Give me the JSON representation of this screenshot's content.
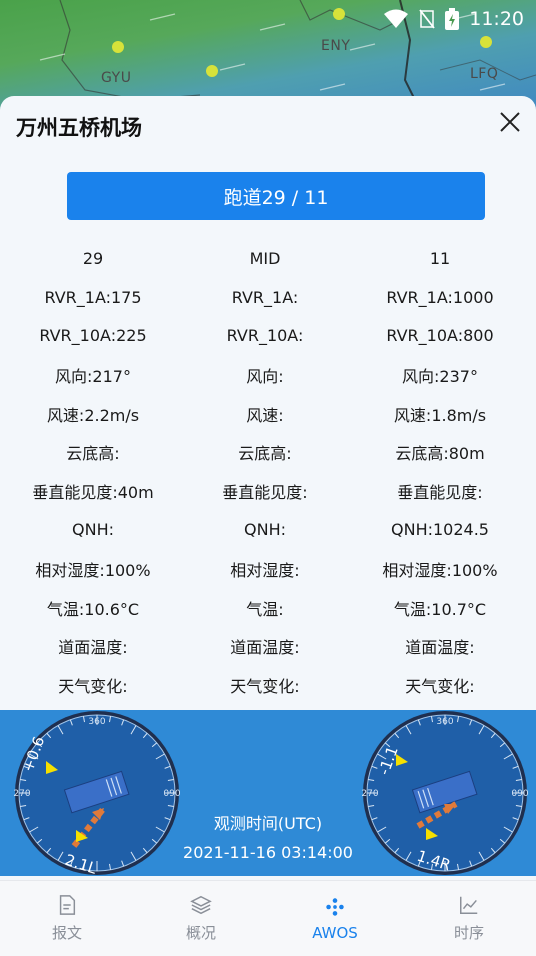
{
  "status_bar": {
    "time": "11:20"
  },
  "map": {
    "labels": [
      "GYU",
      "ENY",
      "LFQ"
    ]
  },
  "sheet": {
    "title": "万州五桥机场",
    "runway_button": "跑道29 / 11"
  },
  "table": {
    "headers": [
      "29",
      "MID",
      "11"
    ],
    "rows": [
      [
        "RVR_1A:175",
        "RVR_1A:",
        "RVR_1A:1000"
      ],
      [
        "RVR_10A:225",
        "RVR_10A:",
        "RVR_10A:800"
      ],
      [
        "风向:217°",
        "风向:",
        "风向:237°"
      ],
      [
        "风速:2.2m/s",
        "风速:",
        "风速:1.8m/s"
      ],
      [
        "云底高:",
        "云底高:",
        "云底高:80m"
      ],
      [
        "垂直能见度:40m",
        "垂直能见度:",
        "垂直能见度:"
      ],
      [
        "QNH:",
        "QNH:",
        "QNH:1024.5"
      ],
      [
        "相对湿度:100%",
        "相对湿度:",
        "相对湿度:100%"
      ],
      [
        "气温:10.6°C",
        "气温:",
        "气温:10.7°C"
      ],
      [
        "道面温度:",
        "道面温度:",
        "道面温度:"
      ],
      [
        "天气变化:",
        "天气变化:",
        "天气变化:"
      ]
    ]
  },
  "gauges": {
    "left": {
      "cross_wind": "+0.6",
      "head_wind": "2.1L",
      "ticks": [
        "360",
        "270",
        "090"
      ]
    },
    "right": {
      "cross_wind": "-1.1",
      "head_wind": "1.4R",
      "ticks": [
        "360",
        "270",
        "090"
      ]
    }
  },
  "observation": {
    "label": "观测时间(UTC)",
    "time": "2021-11-16 03:14:00"
  },
  "nav": {
    "items": [
      {
        "label": "报文",
        "icon": "document-icon"
      },
      {
        "label": "概况",
        "icon": "layers-icon"
      },
      {
        "label": "AWOS",
        "icon": "dots-icon"
      },
      {
        "label": "时序",
        "icon": "trend-icon"
      }
    ],
    "active": "AWOS"
  },
  "colors": {
    "accent": "#1a82ec",
    "band": "#2f8ad6",
    "gauge_bg": "#1f5fa8"
  }
}
